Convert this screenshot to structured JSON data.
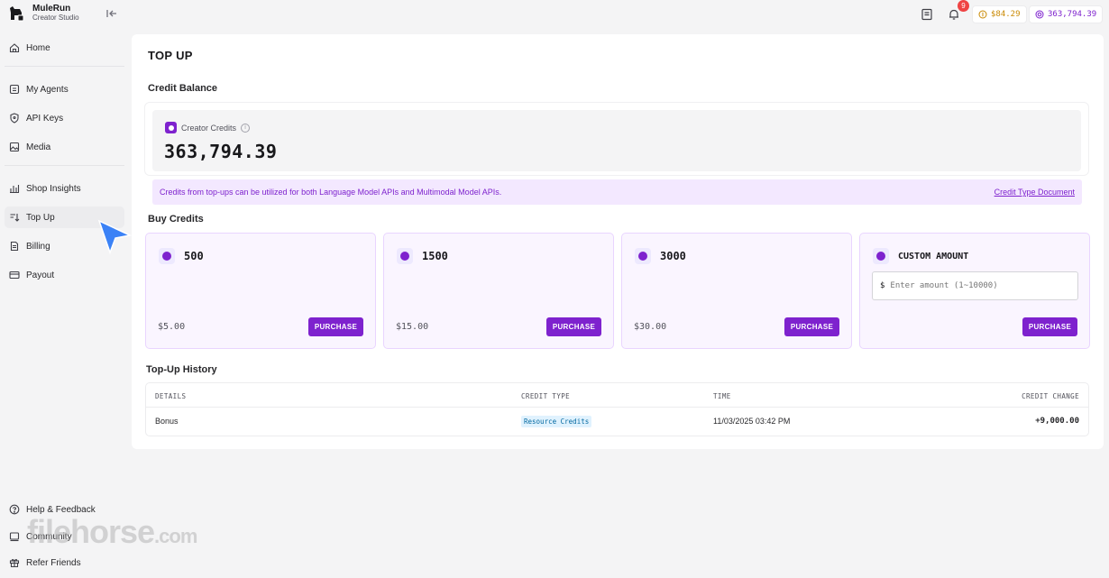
{
  "app": {
    "name": "MuleRun",
    "subtitle": "Creator Studio"
  },
  "sidebar": {
    "items": [
      {
        "label": "Home",
        "icon": "home-icon"
      },
      {
        "label": "My Agents",
        "icon": "agents-icon"
      },
      {
        "label": "API Keys",
        "icon": "shield-icon"
      },
      {
        "label": "Media",
        "icon": "image-icon"
      },
      {
        "label": "Shop Insights",
        "icon": "bar-chart-icon"
      },
      {
        "label": "Top Up",
        "icon": "top-up-icon"
      },
      {
        "label": "Billing",
        "icon": "document-icon"
      },
      {
        "label": "Payout",
        "icon": "card-icon"
      }
    ],
    "footer": [
      {
        "label": "Help & Feedback",
        "icon": "help-icon"
      },
      {
        "label": "Community",
        "icon": "community-icon"
      },
      {
        "label": "Refer Friends",
        "icon": "gift-icon"
      }
    ]
  },
  "topbar": {
    "notification_count": "9",
    "usd_balance": "$84.29",
    "credit_balance": "363,794.39"
  },
  "page": {
    "title": "TOP UP",
    "credit_balance_title": "Credit Balance",
    "creator_credits_label": "Creator Credits",
    "creator_credits_value": "363,794.39",
    "info_text": "Credits from top-ups can be utilized for both Language Model APIs and Multimodal Model APIs.",
    "info_link": "Credit Type Document",
    "buy_title": "Buy Credits",
    "packages": [
      {
        "amount": "500",
        "price": "$5.00",
        "button": "PURCHASE"
      },
      {
        "amount": "1500",
        "price": "$15.00",
        "button": "PURCHASE"
      },
      {
        "amount": "3000",
        "price": "$30.00",
        "button": "PURCHASE"
      }
    ],
    "custom": {
      "title": "CUSTOM AMOUNT",
      "currency": "$",
      "placeholder": "Enter amount (1~10000)",
      "button": "PURCHASE"
    },
    "history": {
      "title": "Top-Up History",
      "columns": [
        "DETAILS",
        "CREDIT TYPE",
        "TIME",
        "CREDIT CHANGE"
      ],
      "rows": [
        {
          "details": "Bonus",
          "type": "Resource Credits",
          "time": "11/03/2025 03:42 PM",
          "change": "+9,000.00"
        }
      ]
    }
  },
  "watermark": {
    "text": "filehorse",
    "suffix": ".com"
  },
  "colors": {
    "accent": "#7e22ce",
    "accent_light": "#f3e8ff",
    "gold": "#ca8a04"
  }
}
